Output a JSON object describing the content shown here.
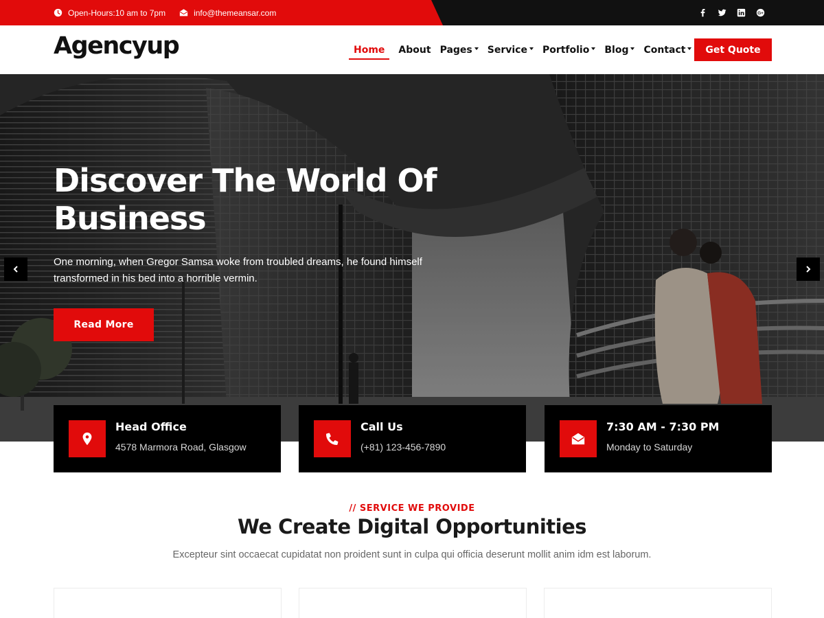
{
  "topbar": {
    "hours": "Open-Hours:10 am to 7pm",
    "email": "info@themeansar.com",
    "social": [
      "facebook-icon",
      "twitter-icon",
      "linkedin-icon",
      "google-plus-icon"
    ],
    "accent_color": "#e10b0b"
  },
  "header": {
    "logo": "Agencyup",
    "nav": [
      {
        "label": "Home",
        "dropdown": false,
        "active": true
      },
      {
        "label": "About",
        "dropdown": false
      },
      {
        "label": "Pages",
        "dropdown": true
      },
      {
        "label": "Service",
        "dropdown": true
      },
      {
        "label": "Portfolio",
        "dropdown": true
      },
      {
        "label": "Blog",
        "dropdown": true
      },
      {
        "label": "Contact",
        "dropdown": true
      }
    ],
    "cta": "Get Quote"
  },
  "hero": {
    "title_line1": "Discover The World Of",
    "title_line2": "Business",
    "text": "One morning, when Gregor Samsa woke from troubled dreams, he found himself transformed in his bed into a horrible vermin.",
    "button": "Read More"
  },
  "info_boxes": [
    {
      "icon": "map-marker-icon",
      "title": "Head Office",
      "subtitle": "4578 Marmora Road, Glasgow"
    },
    {
      "icon": "phone-icon",
      "title": "Call Us",
      "subtitle": "(+81) 123-456-7890"
    },
    {
      "icon": "envelope-open-icon",
      "title": "7:30 AM - 7:30 PM",
      "subtitle": "Monday to Saturday"
    }
  ],
  "services": {
    "kicker": "// SERVICE WE PROVIDE",
    "title": "We Create Digital Opportunities",
    "description": "Excepteur sint occaecat cupidatat non proident sunt in culpa qui officia deserunt mollit anim idm est laborum."
  }
}
